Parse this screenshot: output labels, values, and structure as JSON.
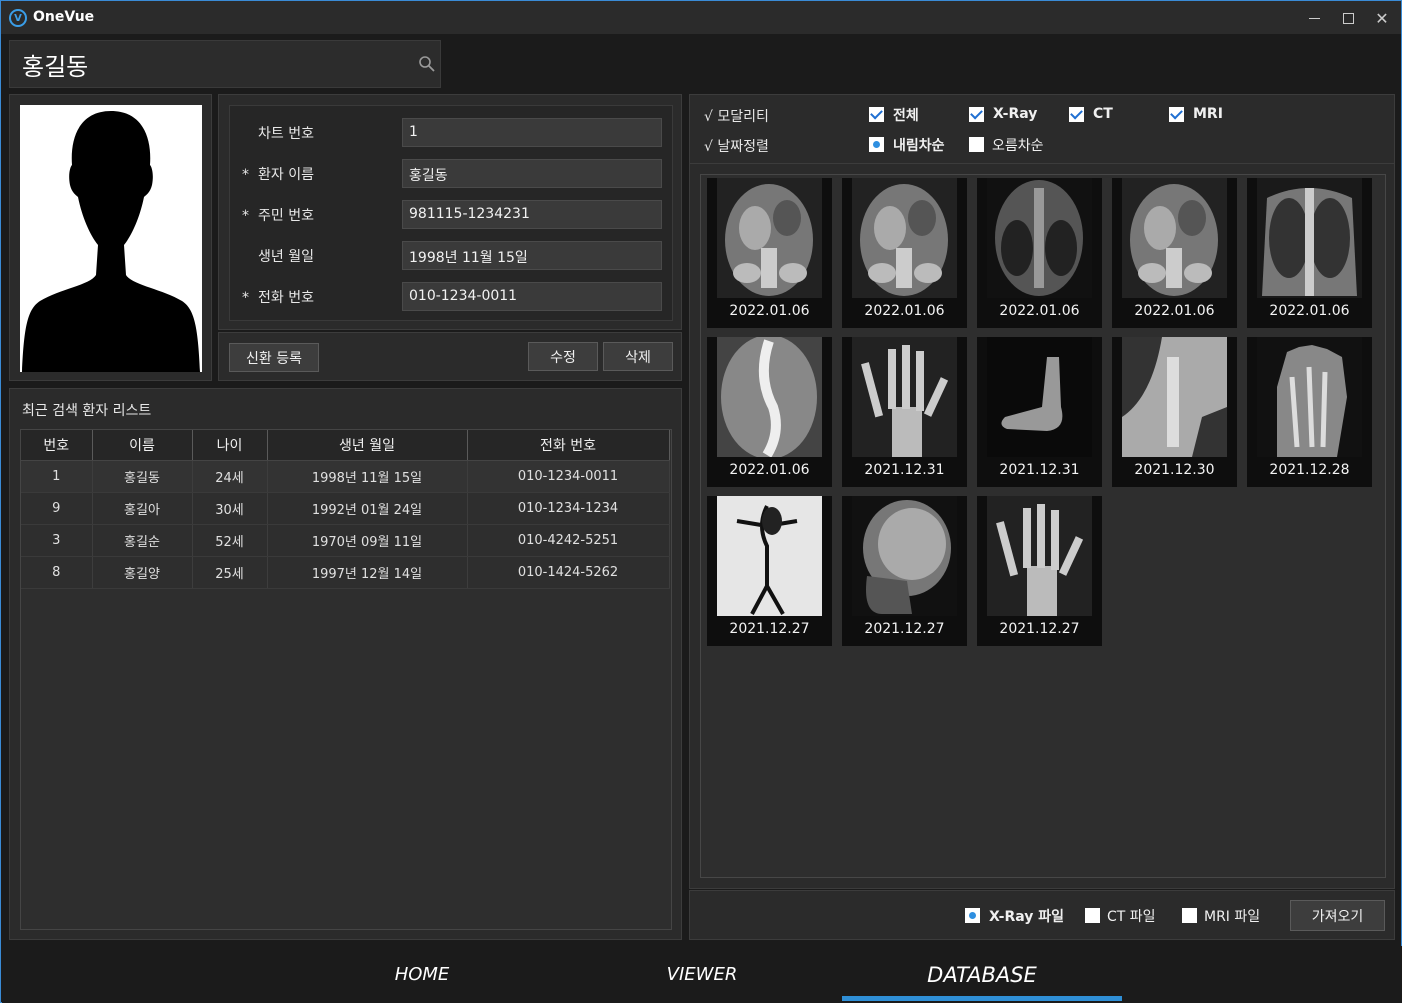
{
  "app": {
    "title": "OneVue"
  },
  "search": {
    "value": "홍길동"
  },
  "form": {
    "rows": [
      {
        "required": "",
        "label": "차트 번호",
        "value": "1"
      },
      {
        "required": "*",
        "label": "환자 이름",
        "value": "홍길동"
      },
      {
        "required": "*",
        "label": "주민 번호",
        "value": "981115-1234231"
      },
      {
        "required": "",
        "label": "생년 월일",
        "value": "1998년 11월 15일"
      },
      {
        "required": "*",
        "label": "전화 번호",
        "value": "010-1234-0011"
      }
    ]
  },
  "actions": {
    "register": "신환 등록",
    "edit": "수정",
    "delete": "삭제"
  },
  "recent": {
    "title": "최근 검색 환자 리스트",
    "headers": [
      "번호",
      "이름",
      "나이",
      "생년 월일",
      "전화 번호"
    ],
    "rows": [
      [
        "1",
        "홍길동",
        "24세",
        "1998년 11월 15일",
        "010-1234-0011"
      ],
      [
        "9",
        "홍길아",
        "30세",
        "1992년 01월 24일",
        "010-1234-1234"
      ],
      [
        "3",
        "홍길순",
        "52세",
        "1970년 09월 11일",
        "010-4242-5251"
      ],
      [
        "8",
        "홍길양",
        "25세",
        "1997년 12월 14일",
        "010-1424-5262"
      ]
    ]
  },
  "filters": {
    "modality_label": "√ 모달리티",
    "date_label": "√ 날짜정렬",
    "modality": {
      "all": "전체",
      "xray": "X-Ray",
      "ct": "CT",
      "mri": "MRI"
    },
    "sort": {
      "desc": "내림차순",
      "asc": "오름차순"
    }
  },
  "gallery": {
    "dates": [
      "2022.01.06",
      "2022.01.06",
      "2022.01.06",
      "2022.01.06",
      "2022.01.06",
      "2022.01.06",
      "2021.12.31",
      "2021.12.31",
      "2021.12.30",
      "2021.12.28",
      "2021.12.27",
      "2021.12.27",
      "2021.12.27"
    ]
  },
  "import": {
    "xray": "X-Ray 파일",
    "ct": "CT 파일",
    "mri": "MRI 파일",
    "button": "가져오기"
  },
  "nav": {
    "home": "HOME",
    "viewer": "VIEWER",
    "database": "DATABASE"
  },
  "colors": {
    "accent": "#2f8fd6",
    "window_bg": "#1b1b1b",
    "panel_bg": "#2b2b2b"
  }
}
